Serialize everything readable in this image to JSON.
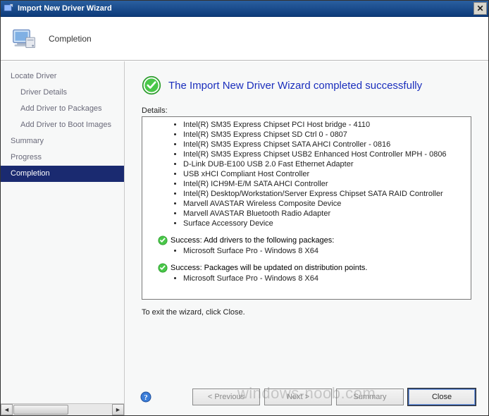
{
  "window": {
    "title": "Import New Driver Wizard"
  },
  "header": {
    "page_title": "Completion"
  },
  "sidebar": {
    "items": [
      {
        "label": "Locate Driver",
        "sub": false
      },
      {
        "label": "Driver Details",
        "sub": true
      },
      {
        "label": "Add Driver to Packages",
        "sub": true
      },
      {
        "label": "Add Driver to Boot Images",
        "sub": true
      },
      {
        "label": "Summary",
        "sub": false
      },
      {
        "label": "Progress",
        "sub": false
      },
      {
        "label": "Completion",
        "sub": false,
        "selected": true
      }
    ]
  },
  "content": {
    "success_message": "The Import New Driver Wizard completed successfully",
    "details_label": "Details:",
    "driver_list": [
      "Intel(R) SM35 Express Chipset PCI Host bridge - 4110",
      "Intel(R) SM35 Express Chipset SD Ctrl 0 - 0807",
      "Intel(R) SM35 Express Chipset SATA AHCI Controller - 0816",
      "Intel(R) SM35 Express Chipset USB2 Enhanced Host Controller MPH - 0806",
      "D-Link DUB-E100 USB 2.0 Fast Ethernet Adapter",
      "USB xHCI Compliant Host Controller",
      "Intel(R) ICH9M-E/M SATA AHCI Controller",
      "Intel(R) Desktop/Workstation/Server Express Chipset SATA RAID Controller",
      "Marvell AVASTAR Wireless Composite Device",
      "Marvell AVASTAR Bluetooth Radio Adapter",
      "Surface Accessory Device"
    ],
    "status_sections": [
      {
        "text": "Success: Add drivers to the following packages:",
        "items": [
          "Microsoft Surface Pro - Windows 8 X64"
        ]
      },
      {
        "text": "Success: Packages will be updated on distribution points.",
        "items": [
          "Microsoft Surface Pro - Windows 8 X64"
        ]
      }
    ],
    "exit_instruction": "To exit the wizard, click Close."
  },
  "buttons": {
    "previous": "< Previous",
    "next": "Next >",
    "summary": "Summary",
    "close": "Close"
  },
  "watermark": "windows-noob.com"
}
